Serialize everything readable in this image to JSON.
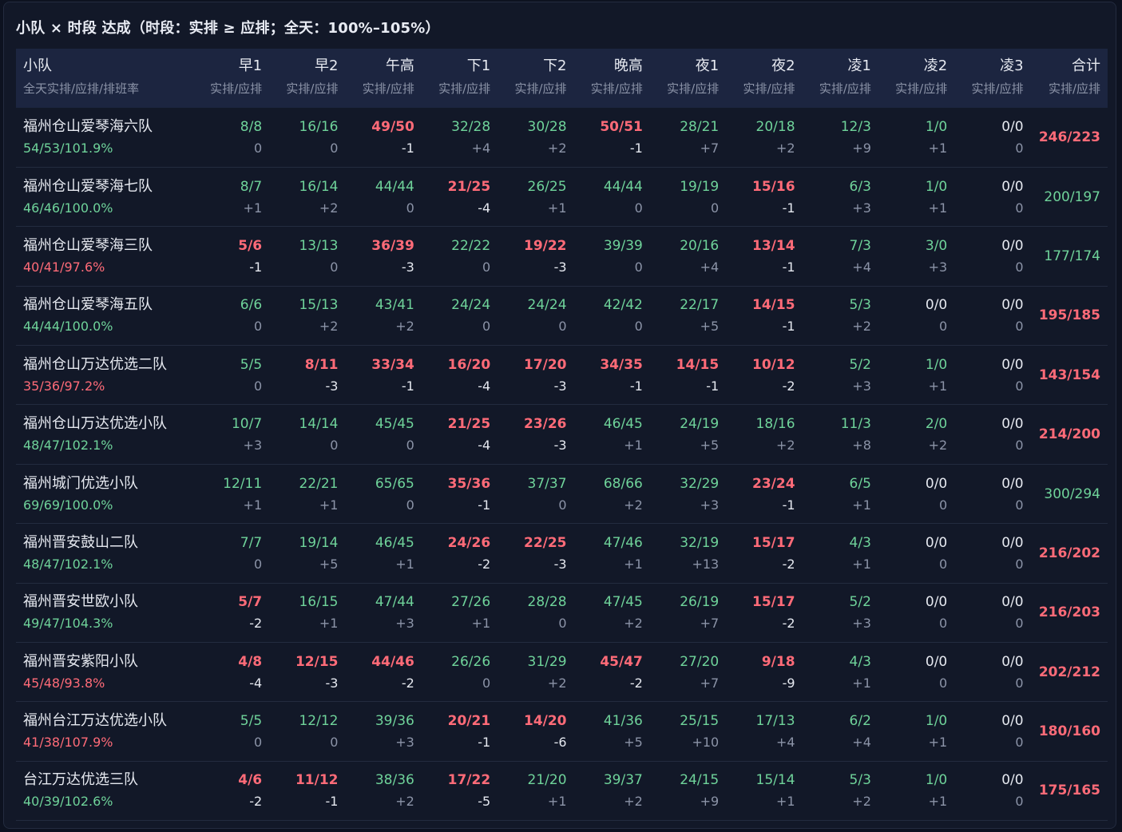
{
  "title": "小队 × 时段 达成（时段：实排 ≥ 应排；全天：100%–105%）",
  "colors": {
    "ok": "#6fd39a",
    "bad": "#ff6b78",
    "neutral": "#e6e9f0"
  },
  "header": {
    "team_label": "小队",
    "team_sub": "全天实排/应排/排班率",
    "slot_sub": "实排/应排",
    "total_label": "合计",
    "slots": [
      "早1",
      "早2",
      "午高",
      "下1",
      "下2",
      "晚高",
      "夜1",
      "夜2",
      "凌1",
      "凌2",
      "凌3"
    ]
  },
  "rows": [
    {
      "name": "福州仓山爱琴海六队",
      "rate": "54/53/101.9%",
      "rate_status": "ok",
      "total": "246/223",
      "total_status": "bad",
      "cells": [
        [
          "8/8",
          "0"
        ],
        [
          "16/16",
          "0"
        ],
        [
          "49/50",
          "-1"
        ],
        [
          "32/28",
          "+4"
        ],
        [
          "30/28",
          "+2"
        ],
        [
          "50/51",
          "-1"
        ],
        [
          "28/21",
          "+7"
        ],
        [
          "20/18",
          "+2"
        ],
        [
          "12/3",
          "+9"
        ],
        [
          "1/0",
          "+1"
        ],
        [
          "0/0",
          "0"
        ]
      ]
    },
    {
      "name": "福州仓山爱琴海七队",
      "rate": "46/46/100.0%",
      "rate_status": "ok",
      "total": "200/197",
      "total_status": "ok",
      "cells": [
        [
          "8/7",
          "+1"
        ],
        [
          "16/14",
          "+2"
        ],
        [
          "44/44",
          "0"
        ],
        [
          "21/25",
          "-4"
        ],
        [
          "26/25",
          "+1"
        ],
        [
          "44/44",
          "0"
        ],
        [
          "19/19",
          "0"
        ],
        [
          "15/16",
          "-1"
        ],
        [
          "6/3",
          "+3"
        ],
        [
          "1/0",
          "+1"
        ],
        [
          "0/0",
          "0"
        ]
      ]
    },
    {
      "name": "福州仓山爱琴海三队",
      "rate": "40/41/97.6%",
      "rate_status": "bad",
      "total": "177/174",
      "total_status": "ok",
      "cells": [
        [
          "5/6",
          "-1"
        ],
        [
          "13/13",
          "0"
        ],
        [
          "36/39",
          "-3"
        ],
        [
          "22/22",
          "0"
        ],
        [
          "19/22",
          "-3"
        ],
        [
          "39/39",
          "0"
        ],
        [
          "20/16",
          "+4"
        ],
        [
          "13/14",
          "-1"
        ],
        [
          "7/3",
          "+4"
        ],
        [
          "3/0",
          "+3"
        ],
        [
          "0/0",
          "0"
        ]
      ]
    },
    {
      "name": "福州仓山爱琴海五队",
      "rate": "44/44/100.0%",
      "rate_status": "ok",
      "total": "195/185",
      "total_status": "bad",
      "cells": [
        [
          "6/6",
          "0"
        ],
        [
          "15/13",
          "+2"
        ],
        [
          "43/41",
          "+2"
        ],
        [
          "24/24",
          "0"
        ],
        [
          "24/24",
          "0"
        ],
        [
          "42/42",
          "0"
        ],
        [
          "22/17",
          "+5"
        ],
        [
          "14/15",
          "-1"
        ],
        [
          "5/3",
          "+2"
        ],
        [
          "0/0",
          "0"
        ],
        [
          "0/0",
          "0"
        ]
      ]
    },
    {
      "name": "福州仓山万达优选二队",
      "rate": "35/36/97.2%",
      "rate_status": "bad",
      "total": "143/154",
      "total_status": "bad",
      "cells": [
        [
          "5/5",
          "0"
        ],
        [
          "8/11",
          "-3"
        ],
        [
          "33/34",
          "-1"
        ],
        [
          "16/20",
          "-4"
        ],
        [
          "17/20",
          "-3"
        ],
        [
          "34/35",
          "-1"
        ],
        [
          "14/15",
          "-1"
        ],
        [
          "10/12",
          "-2"
        ],
        [
          "5/2",
          "+3"
        ],
        [
          "1/0",
          "+1"
        ],
        [
          "0/0",
          "0"
        ]
      ]
    },
    {
      "name": "福州仓山万达优选小队",
      "rate": "48/47/102.1%",
      "rate_status": "ok",
      "total": "214/200",
      "total_status": "bad",
      "cells": [
        [
          "10/7",
          "+3"
        ],
        [
          "14/14",
          "0"
        ],
        [
          "45/45",
          "0"
        ],
        [
          "21/25",
          "-4"
        ],
        [
          "23/26",
          "-3"
        ],
        [
          "46/45",
          "+1"
        ],
        [
          "24/19",
          "+5"
        ],
        [
          "18/16",
          "+2"
        ],
        [
          "11/3",
          "+8"
        ],
        [
          "2/0",
          "+2"
        ],
        [
          "0/0",
          "0"
        ]
      ]
    },
    {
      "name": "福州城门优选小队",
      "rate": "69/69/100.0%",
      "rate_status": "ok",
      "total": "300/294",
      "total_status": "ok",
      "cells": [
        [
          "12/11",
          "+1"
        ],
        [
          "22/21",
          "+1"
        ],
        [
          "65/65",
          "0"
        ],
        [
          "35/36",
          "-1"
        ],
        [
          "37/37",
          "0"
        ],
        [
          "68/66",
          "+2"
        ],
        [
          "32/29",
          "+3"
        ],
        [
          "23/24",
          "-1"
        ],
        [
          "6/5",
          "+1"
        ],
        [
          "0/0",
          "0"
        ],
        [
          "0/0",
          "0"
        ]
      ]
    },
    {
      "name": "福州晋安鼓山二队",
      "rate": "48/47/102.1%",
      "rate_status": "ok",
      "total": "216/202",
      "total_status": "bad",
      "cells": [
        [
          "7/7",
          "0"
        ],
        [
          "19/14",
          "+5"
        ],
        [
          "46/45",
          "+1"
        ],
        [
          "24/26",
          "-2"
        ],
        [
          "22/25",
          "-3"
        ],
        [
          "47/46",
          "+1"
        ],
        [
          "32/19",
          "+13"
        ],
        [
          "15/17",
          "-2"
        ],
        [
          "4/3",
          "+1"
        ],
        [
          "0/0",
          "0"
        ],
        [
          "0/0",
          "0"
        ]
      ]
    },
    {
      "name": "福州晋安世欧小队",
      "rate": "49/47/104.3%",
      "rate_status": "ok",
      "total": "216/203",
      "total_status": "bad",
      "cells": [
        [
          "5/7",
          "-2"
        ],
        [
          "16/15",
          "+1"
        ],
        [
          "47/44",
          "+3"
        ],
        [
          "27/26",
          "+1"
        ],
        [
          "28/28",
          "0"
        ],
        [
          "47/45",
          "+2"
        ],
        [
          "26/19",
          "+7"
        ],
        [
          "15/17",
          "-2"
        ],
        [
          "5/2",
          "+3"
        ],
        [
          "0/0",
          "0"
        ],
        [
          "0/0",
          "0"
        ]
      ]
    },
    {
      "name": "福州晋安紫阳小队",
      "rate": "45/48/93.8%",
      "rate_status": "bad",
      "total": "202/212",
      "total_status": "bad",
      "cells": [
        [
          "4/8",
          "-4"
        ],
        [
          "12/15",
          "-3"
        ],
        [
          "44/46",
          "-2"
        ],
        [
          "26/26",
          "0"
        ],
        [
          "31/29",
          "+2"
        ],
        [
          "45/47",
          "-2"
        ],
        [
          "27/20",
          "+7"
        ],
        [
          "9/18",
          "-9"
        ],
        [
          "4/3",
          "+1"
        ],
        [
          "0/0",
          "0"
        ],
        [
          "0/0",
          "0"
        ]
      ]
    },
    {
      "name": "福州台江万达优选小队",
      "rate": "41/38/107.9%",
      "rate_status": "bad",
      "total": "180/160",
      "total_status": "bad",
      "cells": [
        [
          "5/5",
          "0"
        ],
        [
          "12/12",
          "0"
        ],
        [
          "39/36",
          "+3"
        ],
        [
          "20/21",
          "-1"
        ],
        [
          "14/20",
          "-6"
        ],
        [
          "41/36",
          "+5"
        ],
        [
          "25/15",
          "+10"
        ],
        [
          "17/13",
          "+4"
        ],
        [
          "6/2",
          "+4"
        ],
        [
          "1/0",
          "+1"
        ],
        [
          "0/0",
          "0"
        ]
      ]
    },
    {
      "name": "台江万达优选三队",
      "rate": "40/39/102.6%",
      "rate_status": "ok",
      "total": "175/165",
      "total_status": "bad",
      "cells": [
        [
          "4/6",
          "-2"
        ],
        [
          "11/12",
          "-1"
        ],
        [
          "38/36",
          "+2"
        ],
        [
          "17/22",
          "-5"
        ],
        [
          "21/20",
          "+1"
        ],
        [
          "39/37",
          "+2"
        ],
        [
          "24/15",
          "+9"
        ],
        [
          "15/14",
          "+1"
        ],
        [
          "5/3",
          "+2"
        ],
        [
          "1/0",
          "+1"
        ],
        [
          "0/0",
          "0"
        ]
      ]
    }
  ]
}
